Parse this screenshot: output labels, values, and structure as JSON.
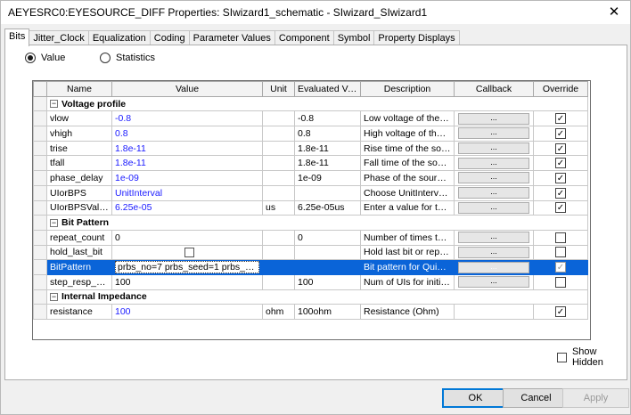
{
  "window": {
    "title": "AEYESRC0:EYESOURCE_DIFF Properties: SIwizard1_schematic - SIwizard_SIwizard1",
    "close_glyph": "✕"
  },
  "tabs": [
    "Bits",
    "Jitter_Clock",
    "Equalization",
    "Coding",
    "Parameter Values",
    "Component",
    "Symbol",
    "Property Displays"
  ],
  "mode": {
    "value_label": "Value",
    "statistics_label": "Statistics",
    "selected": "Value"
  },
  "grid": {
    "headers": [
      "Name",
      "Value",
      "Unit",
      "Evaluated Value",
      "Description",
      "Callback",
      "Override"
    ],
    "groups": [
      {
        "title": "Voltage profile",
        "toggle": "−",
        "rows": [
          {
            "name": "vlow",
            "value": "-0.8",
            "unit": "",
            "evaluated": "-0.8",
            "description": "Low voltage of the sour...",
            "callback": "...",
            "override": true
          },
          {
            "name": "vhigh",
            "value": "0.8",
            "unit": "",
            "evaluated": "0.8",
            "description": "High voltage of the sou...",
            "callback": "...",
            "override": true
          },
          {
            "name": "trise",
            "value": "1.8e-11",
            "unit": "",
            "evaluated": "1.8e-11",
            "description": "Rise time of the source",
            "callback": "...",
            "override": true
          },
          {
            "name": "tfall",
            "value": "1.8e-11",
            "unit": "",
            "evaluated": "1.8e-11",
            "description": "Fall time of the source",
            "callback": "...",
            "override": true
          },
          {
            "name": "phase_delay",
            "value": "1e-09",
            "unit": "",
            "evaluated": "1e-09",
            "description": "Phase of the source in ...",
            "callback": "...",
            "override": true
          },
          {
            "name": "UIorBPS",
            "value": "UnitInterval",
            "unit": "",
            "evaluated": "",
            "description": "Choose UnitInterval or ...",
            "callback": "...",
            "override": true
          },
          {
            "name": "UIorBPSValue",
            "value": "6.25e-05",
            "unit": "us",
            "evaluated": "6.25e-05us",
            "description": "Enter a value for the U...",
            "callback": "...",
            "override": true
          }
        ]
      },
      {
        "title": "Bit Pattern",
        "toggle": "−",
        "rows": [
          {
            "name": "repeat_count",
            "value": "0",
            "unit": "",
            "evaluated": "0",
            "description": "Number of times to rep...",
            "callback": "...",
            "override": false
          },
          {
            "name": "hold_last_bit",
            "value": "",
            "unit": "",
            "evaluated": "",
            "description": "Hold last bit or repeat t...",
            "callback": "...",
            "override": false
          },
          {
            "name": "BitPattern",
            "value": "prbs_no=7 prbs_seed=1 prbs_bitlength=...",
            "unit": "",
            "evaluated": "",
            "description": "Bit pattern for QuickEye",
            "callback": "...",
            "override": true
          },
          {
            "name": "step_resp_nu...",
            "value": "100",
            "unit": "",
            "evaluated": "100",
            "description": "Num of UIs for initial ste...",
            "callback": "...",
            "override": false
          }
        ]
      },
      {
        "title": "Internal Impedance",
        "toggle": "−",
        "rows": [
          {
            "name": "resistance",
            "value": "100",
            "unit": "ohm",
            "evaluated": "100ohm",
            "description": "Resistance (Ohm)",
            "callback": "",
            "override": true
          }
        ]
      }
    ],
    "check_glyph": "✓"
  },
  "show_hidden": {
    "label": "Show Hidden",
    "checked": false
  },
  "buttons": {
    "ok": "OK",
    "cancel": "Cancel",
    "apply": "Apply"
  },
  "colors": {
    "value_text": "#1a1aff",
    "selection": "#0a64d8",
    "ok_border": "#0078d7"
  }
}
